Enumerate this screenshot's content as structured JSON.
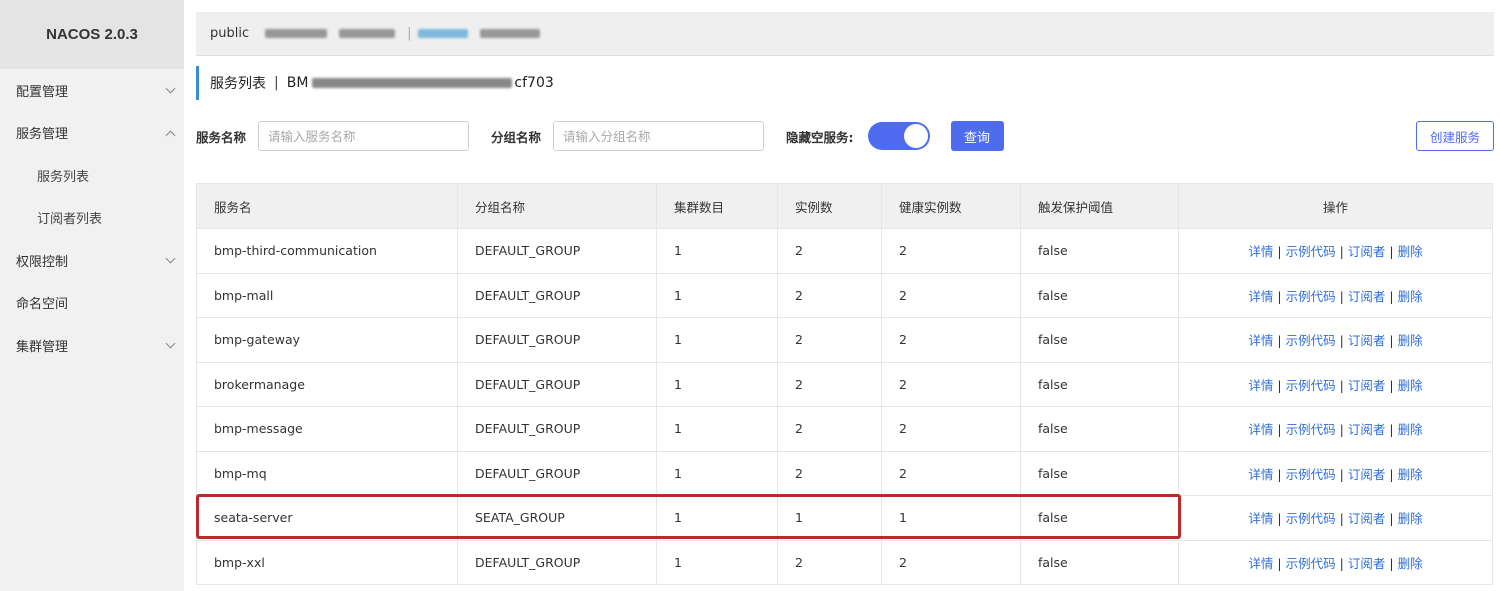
{
  "app": {
    "brand": "NACOS 2.0.3"
  },
  "sidebar": {
    "items": [
      {
        "label": "配置管理",
        "expandable": true,
        "expanded": false
      },
      {
        "label": "服务管理",
        "expandable": true,
        "expanded": true
      },
      {
        "label": "服务列表",
        "sub": true
      },
      {
        "label": "订阅者列表",
        "sub": true
      },
      {
        "label": "权限控制",
        "expandable": true,
        "expanded": false
      },
      {
        "label": "命名空间",
        "expandable": false
      },
      {
        "label": "集群管理",
        "expandable": true,
        "expanded": false
      }
    ]
  },
  "namespace_bar": {
    "current": "public",
    "separator": "|"
  },
  "page": {
    "title": "服务列表",
    "title_separator": "|",
    "namespace_prefix": "BM",
    "namespace_suffix": "cf703"
  },
  "filters": {
    "service_name_label": "服务名称",
    "service_name_placeholder": "请输入服务名称",
    "group_name_label": "分组名称",
    "group_name_placeholder": "请输入分组名称",
    "hide_empty_label": "隐藏空服务:",
    "hide_empty_on": true,
    "query_button": "查询",
    "create_button": "创建服务"
  },
  "table": {
    "columns": [
      "服务名",
      "分组名称",
      "集群数目",
      "实例数",
      "健康实例数",
      "触发保护阈值",
      "操作"
    ],
    "operations": [
      "详情",
      "示例代码",
      "订阅者",
      "删除"
    ],
    "rows": [
      {
        "name": "bmp-third-communication",
        "group": "DEFAULT_GROUP",
        "clusters": "1",
        "instances": "2",
        "healthy": "2",
        "protect": "false"
      },
      {
        "name": "bmp-mall",
        "group": "DEFAULT_GROUP",
        "clusters": "1",
        "instances": "2",
        "healthy": "2",
        "protect": "false"
      },
      {
        "name": "bmp-gateway",
        "group": "DEFAULT_GROUP",
        "clusters": "1",
        "instances": "2",
        "healthy": "2",
        "protect": "false"
      },
      {
        "name": "brokermanage",
        "group": "DEFAULT_GROUP",
        "clusters": "1",
        "instances": "2",
        "healthy": "2",
        "protect": "false"
      },
      {
        "name": "bmp-message",
        "group": "DEFAULT_GROUP",
        "clusters": "1",
        "instances": "2",
        "healthy": "2",
        "protect": "false"
      },
      {
        "name": "bmp-mq",
        "group": "DEFAULT_GROUP",
        "clusters": "1",
        "instances": "2",
        "healthy": "2",
        "protect": "false"
      },
      {
        "name": "seata-server",
        "group": "SEATA_GROUP",
        "clusters": "1",
        "instances": "1",
        "healthy": "1",
        "protect": "false",
        "highlighted": true
      },
      {
        "name": "bmp-xxl",
        "group": "DEFAULT_GROUP",
        "clusters": "1",
        "instances": "2",
        "healthy": "2",
        "protect": "false"
      }
    ]
  },
  "colors": {
    "accent": "#4f6cf1",
    "link": "#2f6fd8",
    "highlight_border": "#b92a2a",
    "title_bar": "#3b8cd4"
  }
}
